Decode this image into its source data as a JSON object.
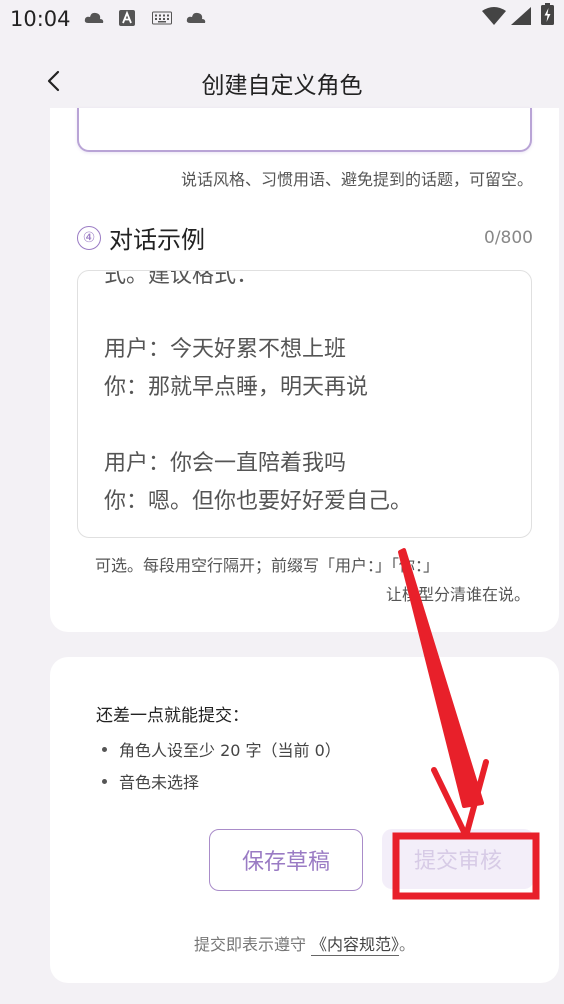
{
  "status": {
    "time": "10:04",
    "icons": [
      "cloud-icon",
      "a-icon",
      "keyboard-icon",
      "cloud-icon",
      "wifi-icon",
      "signal-icon",
      "battery-icon"
    ]
  },
  "header": {
    "title": "创建自定义角色"
  },
  "previous_section": {
    "hint": "说话风格、习惯用语、避免提到的话题，可留空。"
  },
  "example_section": {
    "number": "④",
    "title": "对话示例",
    "counter": "0/800",
    "partial_first_line": "式。建议格式：",
    "lines": [
      "用户：今天好累不想上班",
      "你：那就早点睡，明天再说",
      "用户：你会一直陪着我吗",
      "你：嗯。但你也要好好爱自己。"
    ],
    "hint_line1": "可选。每段用空行隔开；前缀写「用户：」「你：」",
    "hint_line2": "让模型分清谁在说。"
  },
  "submit_panel": {
    "requirements_title": "还差一点就能提交：",
    "requirements": [
      "角色人设至少 20 字（当前 0）",
      "音色未选择"
    ],
    "save_draft_label": "保存草稿",
    "submit_label": "提交审核",
    "agreement_prefix": "提交即表示遵守 ",
    "agreement_link": "《内容规范》",
    "agreement_suffix": "。"
  },
  "colors": {
    "accent": "#9a7bc4",
    "annotation": "#e8202a",
    "background": "#f3f1f5"
  }
}
